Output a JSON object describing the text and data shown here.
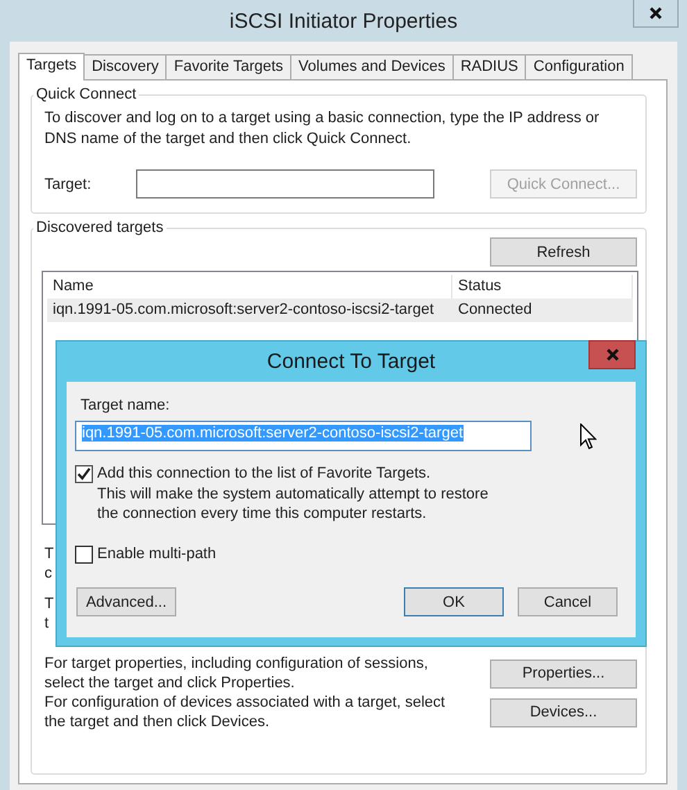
{
  "window": {
    "title": "iSCSI Initiator Properties"
  },
  "tabs": [
    {
      "label": "Targets",
      "selected": true
    },
    {
      "label": "Discovery",
      "selected": false
    },
    {
      "label": "Favorite Targets",
      "selected": false
    },
    {
      "label": "Volumes and Devices",
      "selected": false
    },
    {
      "label": "RADIUS",
      "selected": false
    },
    {
      "label": "Configuration",
      "selected": false
    }
  ],
  "quick_connect": {
    "title": "Quick Connect",
    "description": "To discover and log on to a target using a basic connection, type the IP address or DNS name of the target and then click Quick Connect.",
    "target_label": "Target:",
    "button": {
      "label": "Quick Connect...",
      "disabled": true
    }
  },
  "discovered_targets": {
    "title": "Discovered targets",
    "refresh_button": "Refresh",
    "table": {
      "columns": [
        "Name",
        "Status"
      ],
      "rows": [
        {
          "cells": [
            "iqn.1991-05.com.microsoft:server2-contoso-iscsi2-target",
            "Connected"
          ],
          "selected": true
        }
      ]
    },
    "actions": [
      {
        "lines": [
          "T",
          "c"
        ]
      },
      {
        "lines": [
          "T",
          "t"
        ]
      },
      {
        "lines": [
          "For target properties, including configuration of sessions,",
          "select the target and click Properties."
        ],
        "button": "Properties..."
      },
      {
        "lines": [
          "For configuration of devices associated with a target, select",
          "the target and then click Devices."
        ],
        "button": "Devices..."
      }
    ]
  },
  "dialog": {
    "title": "Connect To Target",
    "target_name_label": "Target name:",
    "target_name_value": "iqn.1991-05.com.microsoft:server2-contoso-iscsi2-target",
    "value_selected": true,
    "options": [
      {
        "label": "Add this connection to the list of Favorite Targets.",
        "note": "This will make the system automatically attempt to restore the connection every time this computer restarts.",
        "checked": true
      },
      {
        "label": "Enable multi-path",
        "checked": false
      }
    ],
    "buttons": [
      {
        "label": "Advanced...",
        "default": false
      },
      {
        "label": "OK",
        "default": true
      },
      {
        "label": "Cancel",
        "default": false
      }
    ]
  }
}
